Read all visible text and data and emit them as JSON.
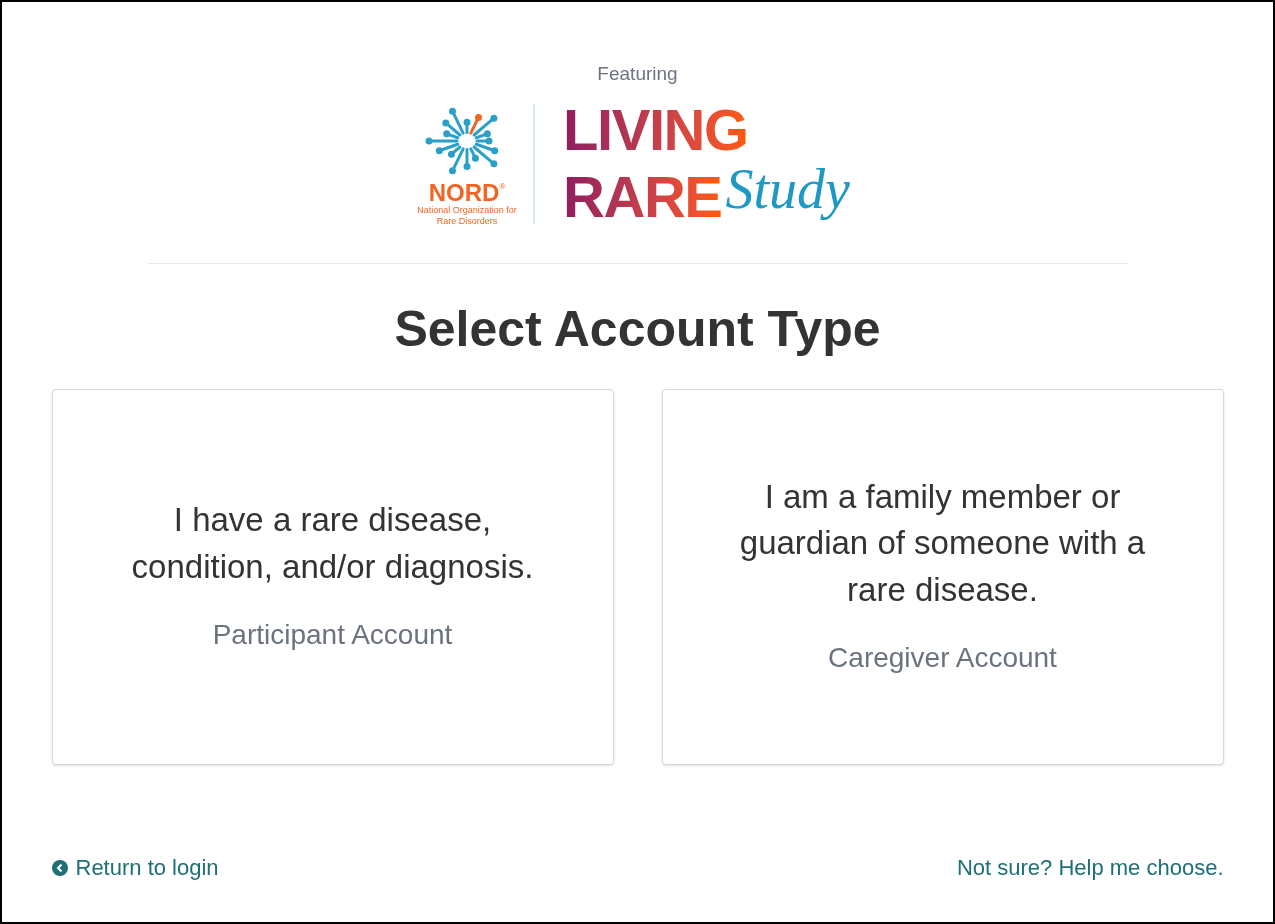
{
  "header": {
    "featuring": "Featuring",
    "nord_logo": {
      "name": "NORD",
      "mark": "®",
      "tagline": "National Organization for Rare Disorders"
    },
    "study_logo": {
      "line_1": "LIVING",
      "line_2": "RARE",
      "word": "Study"
    }
  },
  "title": "Select Account Type",
  "options": [
    {
      "description": "I have a rare disease, condition, and/or diagnosis.",
      "label": "Participant Account"
    },
    {
      "description": "I am a family member or guardian of someone with a rare disease.",
      "label": "Caregiver Account"
    }
  ],
  "footer": {
    "back_link": "Return to login",
    "help_link": "Not sure? Help me choose."
  }
}
